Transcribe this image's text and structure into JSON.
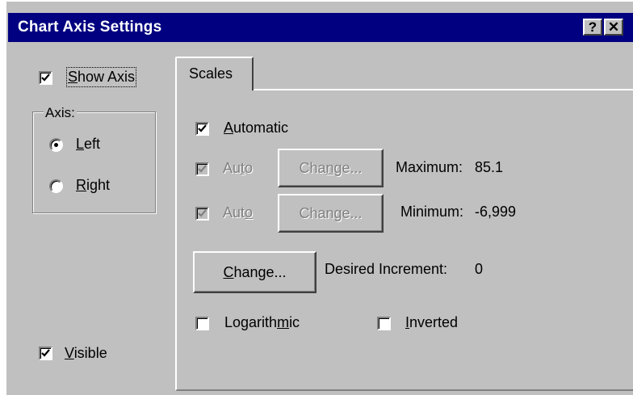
{
  "window": {
    "title": "Chart Axis Settings",
    "help_btn": "?",
    "close_btn": "✕"
  },
  "show_axis": {
    "label_u": "S",
    "label_rest": "how Axis",
    "checked": true
  },
  "axis_group": {
    "label": "Axis:",
    "left": {
      "label_u": "L",
      "label_rest": "eft",
      "selected": true
    },
    "right": {
      "label_u": "R",
      "label_rest": "ight",
      "selected": false
    }
  },
  "visible": {
    "label_u": "V",
    "label_rest": "isible",
    "checked": true
  },
  "tab": {
    "label": "Scales"
  },
  "scales": {
    "automatic": {
      "label_u": "A",
      "label_rest": "utomatic",
      "checked": true
    },
    "max_row": {
      "auto_pre": "Au",
      "auto_u": "t",
      "auto_post": "o",
      "change_pre": "Cha",
      "change_u": "n",
      "change_post": "ge...",
      "label": "Maximum:",
      "value": "85.1"
    },
    "min_row": {
      "auto_pre": "Aut",
      "auto_u": "o",
      "auto_post": "",
      "change_pre": "Chan",
      "change_u": "g",
      "change_post": "e...",
      "label": "Minimum:",
      "value": "-6,999"
    },
    "increment": {
      "change_u": "C",
      "change_rest": "hange...",
      "label": "Desired Increment:",
      "value": "0"
    },
    "logarithmic": {
      "label_pre": "Logarith",
      "label_u": "m",
      "label_post": "ic",
      "checked": false
    },
    "inverted": {
      "label_u": "I",
      "label_rest": "nverted",
      "checked": false
    }
  }
}
